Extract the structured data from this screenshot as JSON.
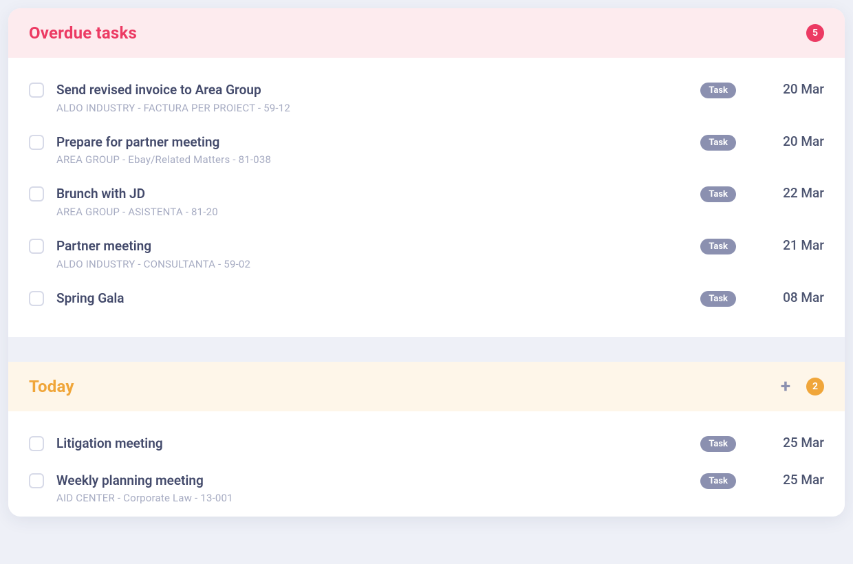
{
  "sections": {
    "overdue": {
      "title": "Overdue tasks",
      "count": "5",
      "tasks": [
        {
          "title": "Send revised invoice to Area Group",
          "sub": "ALDO INDUSTRY - FACTURA PER PROIECT - 59-12",
          "tag": "Task",
          "date": "20 Mar"
        },
        {
          "title": "Prepare for partner meeting",
          "sub": "AREA GROUP - Ebay/Related Matters - 81-038",
          "tag": "Task",
          "date": "20 Mar"
        },
        {
          "title": "Brunch with JD",
          "sub": "AREA GROUP - ASISTENTA - 81-20",
          "tag": "Task",
          "date": "22 Mar"
        },
        {
          "title": "Partner meeting",
          "sub": "ALDO INDUSTRY - CONSULTANTA - 59-02",
          "tag": "Task",
          "date": "21 Mar"
        },
        {
          "title": "Spring Gala",
          "sub": "",
          "tag": "Task",
          "date": "08 Mar"
        }
      ]
    },
    "today": {
      "title": "Today",
      "count": "2",
      "tasks": [
        {
          "title": "Litigation meeting",
          "sub": "",
          "tag": "Task",
          "date": "25 Mar"
        },
        {
          "title": "Weekly planning meeting",
          "sub": "AID CENTER - Corporate Law - 13-001",
          "tag": "Task",
          "date": "25 Mar"
        }
      ]
    }
  }
}
